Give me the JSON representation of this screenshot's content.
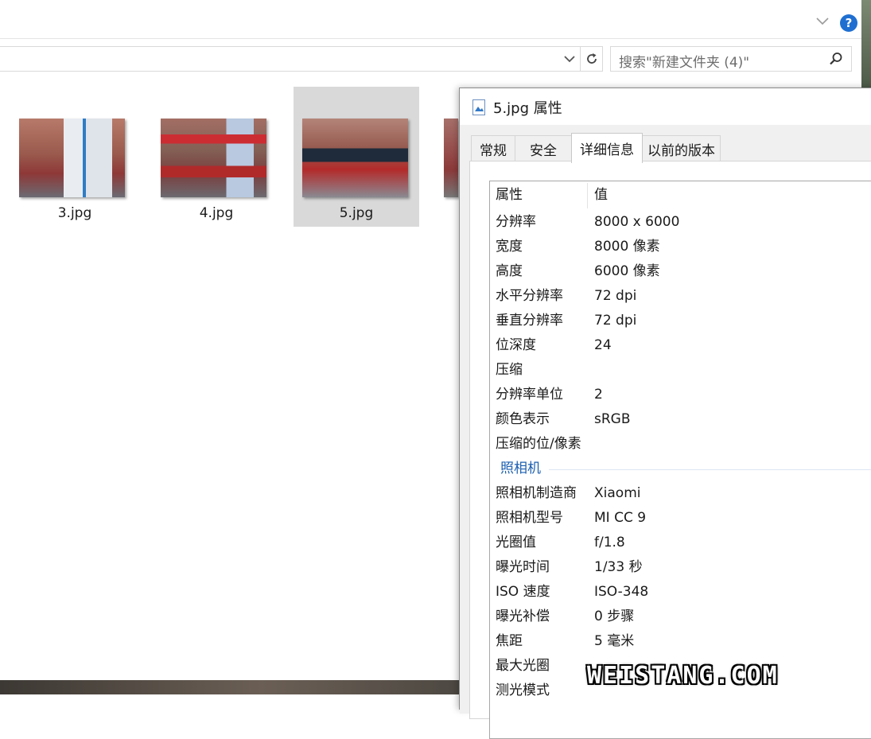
{
  "explorer": {
    "search_placeholder": "搜索\"新建文件夹 (4)\"",
    "help_label": "?",
    "files": [
      {
        "name": "3.jpg",
        "selected": false
      },
      {
        "name": "4.jpg",
        "selected": false
      },
      {
        "name": "5.jpg",
        "selected": true
      }
    ]
  },
  "dialog": {
    "title": "5.jpg 属性",
    "tabs": [
      "常规",
      "安全",
      "详细信息",
      "以前的版本"
    ],
    "active_tab": "详细信息",
    "header_name": "属性",
    "header_value": "值",
    "image_rows": [
      {
        "name": "分辨率",
        "value": "8000 x 6000"
      },
      {
        "name": "宽度",
        "value": "8000 像素"
      },
      {
        "name": "高度",
        "value": "6000 像素"
      },
      {
        "name": "水平分辨率",
        "value": "72 dpi"
      },
      {
        "name": "垂直分辨率",
        "value": "72 dpi"
      },
      {
        "name": "位深度",
        "value": "24"
      },
      {
        "name": "压缩",
        "value": ""
      },
      {
        "name": "分辨率单位",
        "value": "2"
      },
      {
        "name": "颜色表示",
        "value": "sRGB"
      },
      {
        "name": "压缩的位/像素",
        "value": ""
      }
    ],
    "camera_group": "照相机",
    "camera_rows": [
      {
        "name": "照相机制造商",
        "value": "Xiaomi"
      },
      {
        "name": "照相机型号",
        "value": "MI CC 9"
      },
      {
        "name": "光圈值",
        "value": "f/1.8"
      },
      {
        "name": "曝光时间",
        "value": "1/33 秒"
      },
      {
        "name": "ISO 速度",
        "value": "ISO-348"
      },
      {
        "name": "曝光补偿",
        "value": "0 步骤"
      },
      {
        "name": "焦距",
        "value": "5 毫米"
      },
      {
        "name": "最大光圈",
        "value": ""
      },
      {
        "name": "测光模式",
        "value": ""
      }
    ]
  },
  "watermark": "WEISTANG.COM",
  "colors": {
    "accent": "#1f6fd1",
    "group_label": "#1b5fb0",
    "selection": "#d9d9d9"
  }
}
